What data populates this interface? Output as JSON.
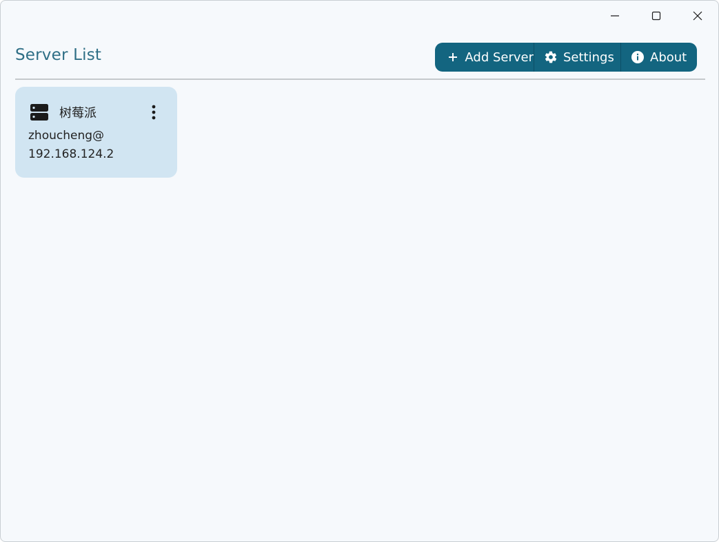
{
  "window": {
    "controls": {
      "minimize_icon": "minimize-icon",
      "maximize_icon": "maximize-icon",
      "close_icon": "close-icon"
    }
  },
  "header": {
    "title": "Server List"
  },
  "toolbar": {
    "add_server_label": "Add Server",
    "settings_label": "Settings",
    "about_label": "About"
  },
  "servers": [
    {
      "name": "树莓派",
      "user": "zhoucheng@",
      "host": "192.168.124.2",
      "icon": "server-icon"
    }
  ],
  "colors": {
    "accent": "#136580",
    "title": "#2f6f86",
    "card_bg": "#d1e5f2",
    "window_bg": "#f6f9fc"
  }
}
